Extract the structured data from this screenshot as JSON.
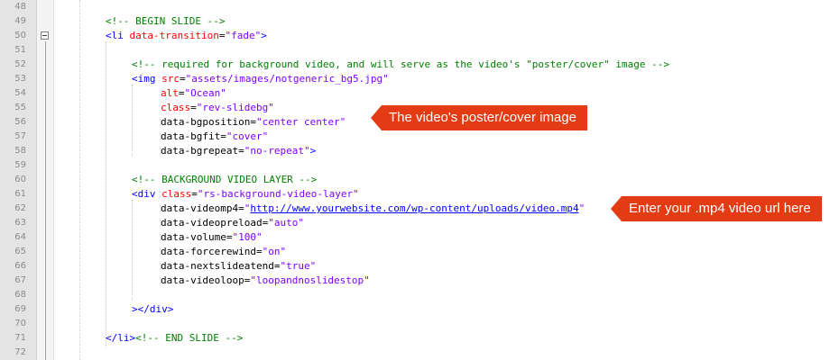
{
  "line_numbers": [
    "48",
    "49",
    "50",
    "51",
    "52",
    "53",
    "54",
    "55",
    "56",
    "57",
    "58",
    "59",
    "60",
    "61",
    "62",
    "63",
    "64",
    "65",
    "66",
    "67",
    "68",
    "69",
    "70",
    "71",
    "72"
  ],
  "code": {
    "l49_comment": "<!-- BEGIN SLIDE -->",
    "l50_open": "<li ",
    "l50_attr": "data-transition",
    "l50_eq": "=",
    "l50_val": "\"fade\"",
    "l50_close": ">",
    "l52_comment": "<!-- required for background video, and will serve as the video's \"poster/cover\" image -->",
    "l53_open": "<img ",
    "l53_attr": "src",
    "l53_eq": "=",
    "l53_val": "\"assets/images/notgeneric_bg5.jpg\"",
    "l54_attr": "alt",
    "l54_eq": "=",
    "l54_val": "\"Ocean\"",
    "l55_attr": "class",
    "l55_eq": "=",
    "l55_val": "\"rev-slidebg\"",
    "l56_attr": "data-bgposition",
    "l56_eq": "=",
    "l56_val": "\"center center\"",
    "l57_attr": "data-bgfit",
    "l57_eq": "=",
    "l57_val": "\"cover\"",
    "l58_attr": "data-bgrepeat",
    "l58_eq": "=",
    "l58_val": "\"no-repeat\"",
    "l58_close": ">",
    "l60_comment": "<!-- BACKGROUND VIDEO LAYER -->",
    "l61_open": "<div ",
    "l61_attr": "class",
    "l61_eq": "=",
    "l61_val": "\"rs-background-video-layer\"",
    "l62_attr": "data-videomp4",
    "l62_eq": "=",
    "l62_q1": "\"",
    "l62_url": "http://www.yourwebsite.com/wp-content/uploads/video.mp4",
    "l62_q2": "\"",
    "l63_attr": "data-videopreload",
    "l63_eq": "=",
    "l63_val": "\"auto\"",
    "l64_attr": "data-volume",
    "l64_eq": "=",
    "l64_val": "\"100\"",
    "l65_attr": "data-forcerewind",
    "l65_eq": "=",
    "l65_val": "\"on\"",
    "l66_attr": "data-nextslideatend",
    "l66_eq": "=",
    "l66_val": "\"true\"",
    "l67_attr": "data-videoloop",
    "l67_eq": "=",
    "l67_val": "\"loopandnoslidestop\"",
    "l69_close": "></div>",
    "l71_close": "</li>",
    "l71_comment": "<!-- END SLIDE -->"
  },
  "callouts": {
    "poster": "The video's poster/cover image",
    "mp4": "Enter your .mp4 video url here"
  },
  "colors": {
    "callout_bg": "#e33b14",
    "comment": "#008000",
    "tag": "#0000ff",
    "attribute": "#ff0000",
    "string": "#8000ff",
    "line_number": "#8b8b8b"
  }
}
